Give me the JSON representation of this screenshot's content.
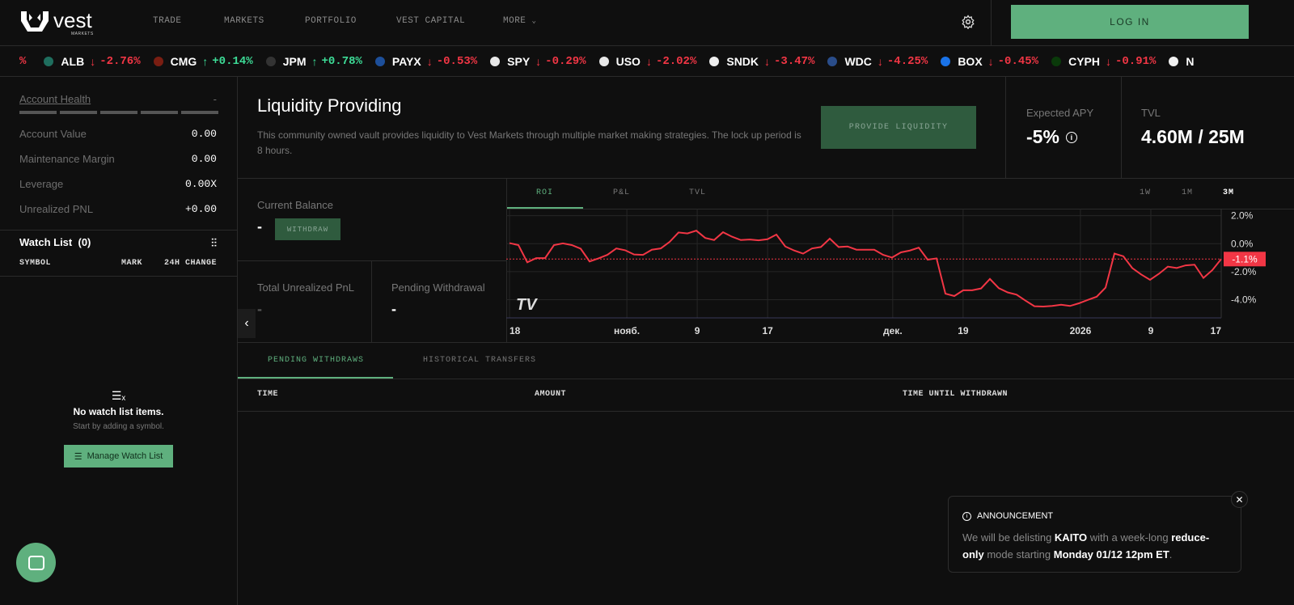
{
  "header": {
    "brand": "vest",
    "brand_sub": "MARKETS",
    "nav": [
      "TRADE",
      "MARKETS",
      "PORTFOLIO",
      "VEST CAPITAL",
      "MORE"
    ],
    "login": "LOG IN"
  },
  "ticker": {
    "lead": "%",
    "items": [
      {
        "sym": "ALB",
        "chg": "-2.76%",
        "dir": "down",
        "color": "#1f6e5e"
      },
      {
        "sym": "CMG",
        "chg": "+0.14%",
        "dir": "up",
        "color": "#7a1e12"
      },
      {
        "sym": "JPM",
        "chg": "+0.78%",
        "dir": "up",
        "color": "#333333"
      },
      {
        "sym": "PAYX",
        "chg": "-0.53%",
        "dir": "down",
        "color": "#1d4f9a"
      },
      {
        "sym": "SPY",
        "chg": "-0.29%",
        "dir": "down",
        "color": "#e8e8e8"
      },
      {
        "sym": "USO",
        "chg": "-2.02%",
        "dir": "down",
        "color": "#e8e8e8"
      },
      {
        "sym": "SNDK",
        "chg": "-3.47%",
        "dir": "down",
        "color": "#eeeeee"
      },
      {
        "sym": "WDC",
        "chg": "-4.25%",
        "dir": "down",
        "color": "#2a4d8a"
      },
      {
        "sym": "BOX",
        "chg": "-0.45%",
        "dir": "down",
        "color": "#1a73e8"
      },
      {
        "sym": "CYPH",
        "chg": "-0.91%",
        "dir": "down",
        "color": "#0a3a0a"
      },
      {
        "sym": "N",
        "chg": "",
        "dir": "",
        "color": "#f0f0f0"
      }
    ]
  },
  "account": {
    "health_label": "Account Health",
    "health_value": "-",
    "rows": [
      {
        "label": "Account Value",
        "value": "0.00"
      },
      {
        "label": "Maintenance Margin",
        "value": "0.00"
      },
      {
        "label": "Leverage",
        "value": "0.00X"
      },
      {
        "label": "Unrealized PNL",
        "value": "+0.00"
      }
    ]
  },
  "watchlist": {
    "title": "Watch List",
    "count": "(0)",
    "cols": [
      "SYMBOL",
      "MARK",
      "24H CHANGE"
    ],
    "empty_title": "No watch list items.",
    "empty_sub": "Start by adding a symbol.",
    "manage": "Manage Watch List"
  },
  "vault": {
    "title": "Liquidity Providing",
    "desc": "This community owned vault provides liquidity to Vest Markets through multiple market making strategies. The lock up period is 8 hours.",
    "provide": "PROVIDE LIQUIDITY",
    "apy_label": "Expected APY",
    "apy": "-5%",
    "tvl_label": "TVL",
    "tvl": "4.60M / 25M"
  },
  "balance": {
    "label": "Current Balance",
    "value": "-",
    "withdraw": "WITHDRAW",
    "pnl_label": "Total Unrealized PnL",
    "pnl": "-",
    "pending_label": "Pending Withdrawal",
    "pending": "-"
  },
  "chart_tabs": [
    "ROI",
    "P&L",
    "TVL"
  ],
  "ranges": [
    "1W",
    "1M",
    "3M"
  ],
  "chart_data": {
    "type": "line",
    "title": "ROI",
    "series": [
      {
        "name": "ROI",
        "values": [
          0.04,
          -0.1,
          -1.33,
          -1.03,
          -1.03,
          -0.1,
          0.02,
          -0.1,
          -0.36,
          -1.27,
          -1.05,
          -0.8,
          -0.34,
          -0.47,
          -0.77,
          -0.8,
          -0.43,
          -0.34,
          0.13,
          0.8,
          0.73,
          0.93,
          0.41,
          0.26,
          0.82,
          0.5,
          0.26,
          0.3,
          0.24,
          0.32,
          0.65,
          -0.2,
          -0.49,
          -0.71,
          -0.34,
          -0.24,
          0.36,
          -0.24,
          -0.2,
          -0.43,
          -0.43,
          -0.43,
          -0.8,
          -0.99,
          -0.62,
          -0.49,
          -0.28,
          -1.14,
          -1.05,
          -3.57,
          -3.74,
          -3.33,
          -3.33,
          -3.2,
          -2.52,
          -3.18,
          -3.48,
          -3.64,
          -4.07,
          -4.47,
          -4.49,
          -4.45,
          -4.36,
          -4.45,
          -4.26,
          -4.02,
          -3.79,
          -3.14,
          -0.71,
          -0.9,
          -1.74,
          -2.2,
          -2.58,
          -2.15,
          -1.64,
          -1.74,
          -1.55,
          -1.5,
          -2.45,
          -1.89,
          -1.1
        ]
      }
    ],
    "x_ticks": [
      {
        "day": 0,
        "label": "18"
      },
      {
        "day": 15,
        "label": "нояб."
      },
      {
        "day": 24,
        "label": "9"
      },
      {
        "day": 33,
        "label": "17"
      },
      {
        "day": 49,
        "label": "дек."
      },
      {
        "day": 58,
        "label": "19"
      },
      {
        "day": 73,
        "label": "2026"
      },
      {
        "day": 82,
        "label": "9"
      },
      {
        "day": 91,
        "label": "17"
      }
    ],
    "x_days": 91,
    "y_ticks": [
      {
        "v": 2,
        "label": "2.0%"
      },
      {
        "v": 0,
        "label": "0.0%"
      },
      {
        "v": -2,
        "label": "-2.0%"
      },
      {
        "v": -4,
        "label": "-4.0%"
      }
    ],
    "ylim": [
      -5.3,
      2.5
    ],
    "last": {
      "v": -1.1,
      "label": "-1.1%"
    },
    "color": "#f23645"
  },
  "transfers": {
    "tabs": [
      "PENDING WITHDRAWS",
      "HISTORICAL TRANSFERS"
    ],
    "cols": [
      "TIME",
      "AMOUNT",
      "TIME UNTIL WITHDRAWN"
    ]
  },
  "announcement": {
    "title": "ANNOUNCEMENT",
    "t1": "We will be delisting ",
    "b1": "KAITO",
    "t2": " with a week-long ",
    "b2": "reduce-only",
    "t3": " mode starting ",
    "b3": "Monday 01/12 12pm ET",
    "t4": "."
  }
}
